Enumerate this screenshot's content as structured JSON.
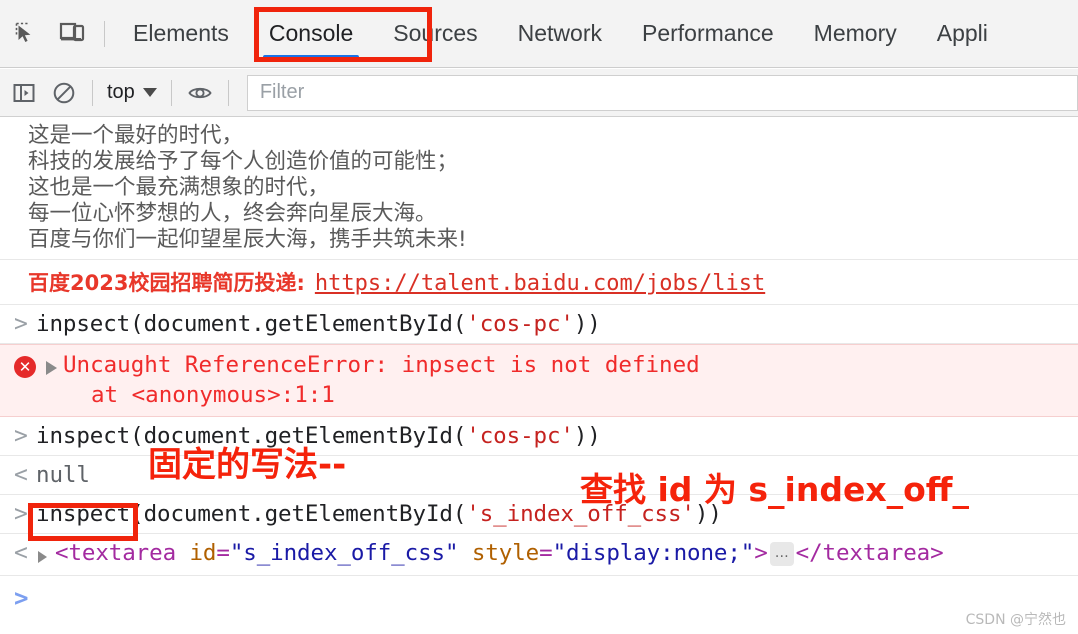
{
  "devtools": {
    "toolbar_icons": [
      {
        "name": "inspect-element-icon",
        "title": "Inspect element"
      },
      {
        "name": "device-toolbar-icon",
        "title": "Toggle device toolbar"
      }
    ],
    "tabs": [
      {
        "label": "Elements",
        "active": false
      },
      {
        "label": "Console",
        "active": true
      },
      {
        "label": "Sources",
        "active": false
      },
      {
        "label": "Network",
        "active": false
      },
      {
        "label": "Performance",
        "active": false
      },
      {
        "label": "Memory",
        "active": false
      },
      {
        "label": "Appli",
        "active": false
      }
    ],
    "accent_color": "#1a73e8",
    "tabbar_bg": "#f3f3f3"
  },
  "filterbar": {
    "sidebar_toggle": "show-console-sidebar-icon",
    "clear_console": "clear-console-icon",
    "context_label": "top",
    "eye_icon": "live-expression-icon",
    "filter_placeholder": "Filter"
  },
  "console": {
    "banner_lines": [
      "这是一个最好的时代，",
      "科技的发展给予了每个人创造价值的可能性；",
      "这也是一个最充满想象的时代，",
      "每一位心怀梦想的人，终会奔向星辰大海。",
      "百度与你们一起仰望星辰大海，携手共筑未来!"
    ],
    "link_row": {
      "label": "百度2023校园招聘简历投递:",
      "url": "https://talent.baidu.com/jobs/list",
      "label_color": "#e8372a",
      "url_color": "#d93025"
    },
    "entry1": {
      "prompt": ">",
      "code_prefix": "inpsect(document.getElementById(",
      "code_string": "'cos-pc'",
      "code_suffix": "))"
    },
    "error": {
      "icon": "error-circle-icon",
      "message": "Uncaught ReferenceError: inpsect is not defined",
      "stack": "at <anonymous>:1:1",
      "bg": "#fff0f0",
      "text_color": "#f02b2b"
    },
    "entry2": {
      "prompt": ">",
      "code_prefix": "inspect(document.getElementById(",
      "code_string": "'cos-pc'",
      "code_suffix": "))"
    },
    "result2": {
      "prompt": "<",
      "value": "null"
    },
    "entry3": {
      "prompt": ">",
      "highlight_token": "inspect",
      "code_prefix": "(document.getElementById(",
      "code_string": "'s_index_off_css'",
      "code_suffix": "))"
    },
    "result3": {
      "prompt": "<",
      "tag_open": "<textarea",
      "attr1_name": "id",
      "attr1_value": "\"s_index_off_css\"",
      "attr2_name": "style",
      "attr2_value": "\"display:none;\"",
      "tag_close_bracket": ">",
      "collapsed_content": "…",
      "tag_end": "</textarea>"
    },
    "final_prompt": ">"
  },
  "annotations": {
    "color": "#f5230b",
    "console_tab_box": {
      "name": "console-tab-highlight-box"
    },
    "inspect_token_box": {
      "name": "inspect-token-highlight-box"
    },
    "note_left": "固定的写法--",
    "note_right": "查找 id 为 s_index_off_"
  },
  "watermark": "CSDN @宁然也"
}
